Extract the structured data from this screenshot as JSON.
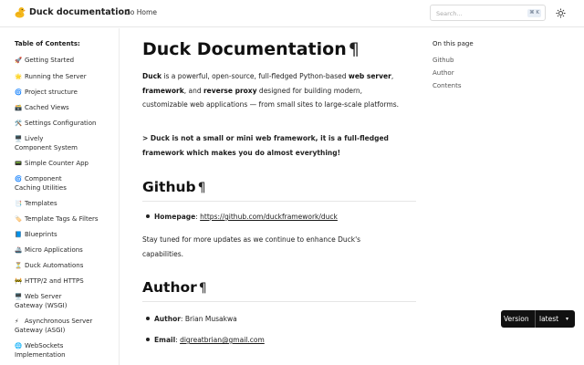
{
  "header": {
    "brand": "Duck documentation",
    "nav_link": "Go Home",
    "search_placeholder": "Search...",
    "search_shortcut": "⌘ K"
  },
  "sidebar": {
    "title": "Table of Contents:",
    "items": [
      {
        "icon": "🚀",
        "label": "Getting Started"
      },
      {
        "icon": "🌟",
        "label": "Running the Server"
      },
      {
        "icon": "🌀",
        "label": "Project structure"
      },
      {
        "icon": "🗃️",
        "label": "Cached Views"
      },
      {
        "icon": "🛠️",
        "label": "Settings Configuration"
      },
      {
        "icon": "🖥️",
        "label": "Lively"
      },
      {
        "icon": "",
        "label": "Component System"
      },
      {
        "icon": "📟",
        "label": "Simple Counter App"
      },
      {
        "icon": "🌀",
        "label": "Component"
      },
      {
        "icon": "",
        "label": "Caching Utilities"
      },
      {
        "icon": "📑",
        "label": "Templates"
      },
      {
        "icon": "🏷️",
        "label": "Template Tags & Filters"
      },
      {
        "icon": "📘",
        "label": "Blueprints"
      },
      {
        "icon": "🚢",
        "label": "Micro Applications"
      },
      {
        "icon": "⏳",
        "label": "Duck Automations"
      },
      {
        "icon": "🚧",
        "label": "HTTP/2 and HTTPS"
      },
      {
        "icon": "🖥️",
        "label": "Web Server"
      },
      {
        "icon": "",
        "label": "Gateway (WSGI)"
      },
      {
        "icon": "⚡",
        "label": "Asynchronous Server"
      },
      {
        "icon": "",
        "label": "Gateway (ASGI)"
      },
      {
        "icon": "🌐",
        "label": "WebSockets"
      },
      {
        "icon": "",
        "label": "Implementation"
      }
    ]
  },
  "main": {
    "title": "Duck Documentation",
    "pilcrow": "¶",
    "intro": {
      "t1": "Duck",
      "t2": " is a powerful, open-source, full-fledged Python-based ",
      "t3": "web server",
      "t4": ", ",
      "t5": "framework",
      "t6": ", and ",
      "t7": "reverse proxy",
      "t8": " designed for building modern, customizable web applications — from small sites to large-scale platforms."
    },
    "quote": "> Duck is not a small or mini web framework, it is a full-fledged framework which makes you do almost everything!",
    "github": {
      "heading": "Github",
      "homepage_label": "Homepage",
      "homepage_sep": ": ",
      "homepage_url": "https://github.com/duckframework/duck",
      "note": "Stay tuned for more updates as we continue to enhance Duck's capabilities."
    },
    "author": {
      "heading": "Author",
      "author_label": "Author",
      "author_value": ": Brian Musakwa",
      "email_label": "Email",
      "email_sep": ": ",
      "email_value": "digreatbrian@gmail.com"
    }
  },
  "on_this_page": {
    "title": "On this page",
    "items": [
      "Github",
      "Author",
      "Contents"
    ]
  },
  "version_badge": {
    "label": "Version",
    "selected": "latest"
  },
  "colors": {
    "text": "#1a1a1a",
    "border": "#e6e6e6",
    "badge_bg": "#111111",
    "duck_yellow": "#f5b81c",
    "duck_orange": "#e87a1e"
  }
}
